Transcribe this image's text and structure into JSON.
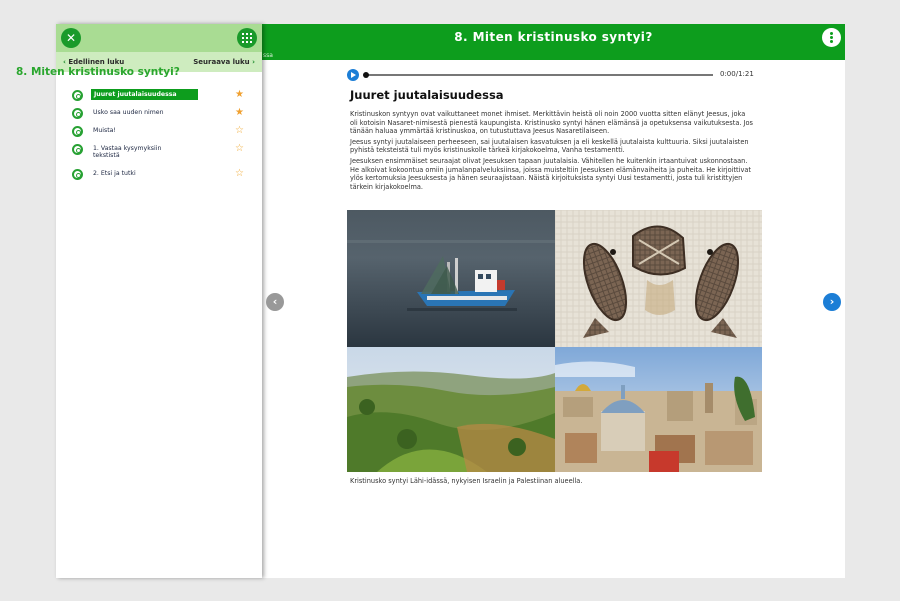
{
  "sidebar": {
    "prev_label": "Edellinen luku",
    "next_label": "Seuraava luku",
    "chapter_title": "8. Miten kristinusko syntyi?",
    "items": [
      {
        "label": "Juuret juutalaisuudessa",
        "active": true,
        "starred": true,
        "icon": "target-icon"
      },
      {
        "label": "Usko saa uuden nimen",
        "active": false,
        "starred": true,
        "icon": "target-icon"
      },
      {
        "label": "Muista!",
        "active": false,
        "starred": false,
        "icon": "target-icon"
      },
      {
        "label": "1. Vastaa kysymyksiin tekstistä",
        "active": false,
        "starred": false,
        "icon": "target-icon"
      },
      {
        "label": "2. Etsi ja tutki",
        "active": false,
        "starred": false,
        "icon": "target-icon"
      }
    ]
  },
  "header": {
    "title": "8. Miten kristinusko syntyi?",
    "sub_label": "ssa"
  },
  "audio": {
    "time": "0:00/1:21",
    "progress": 0
  },
  "article": {
    "title": "Juuret juutalaisuudessa",
    "paragraphs": [
      "Kristinuskon syntyyn ovat vaikuttaneet monet ihmiset. Merkittävin heistä oli noin 2000 vuotta sitten elänyt Jeesus, joka oli kotoisin Nasaret-nimisestä pienestä kaupungista. Kristinusko syntyi hänen elämänsä ja opetuksensa vaikutuksesta. Jos tänään haluaa ymmärtää kristinuskoa, on tutustuttava Jeesus Nasaretilaiseen.",
      "Jeesus syntyi juutalaiseen perheeseen, sai juutalaisen kasvatuksen ja eli keskellä juutalaista kulttuuria. Siksi juutalaisten pyhistä teksteistä tuli myös kristinuskolle tärkeä kirjakokoelma, Vanha testamentti.",
      "Jeesuksen ensimmäiset seuraajat olivat Jeesuksen tapaan juutalaisia. Vähitellen he kuitenkin irtaantuivat uskonnostaan. He alkoivat kokoontua omiin jumalanpalveluksiinsa, joissa muisteltiin Jeesuksen elämänvaiheita ja puheita. He kirjoittivat ylös kertomuksia Jeesuksesta ja hänen seuraajistaan. Näistä kirjoituksista syntyi Uusi testamentti, josta tuli kristittyjen tärkein kirjakokoelma."
    ],
    "caption": "Kristinusko syntyi Lähi-idässä, nykyisen Israelin ja Palestiinan alueella."
  },
  "colors": {
    "brand_green": "#0d9d1d",
    "accent_blue": "#1c7ed6",
    "star_orange": "#f0a030"
  }
}
